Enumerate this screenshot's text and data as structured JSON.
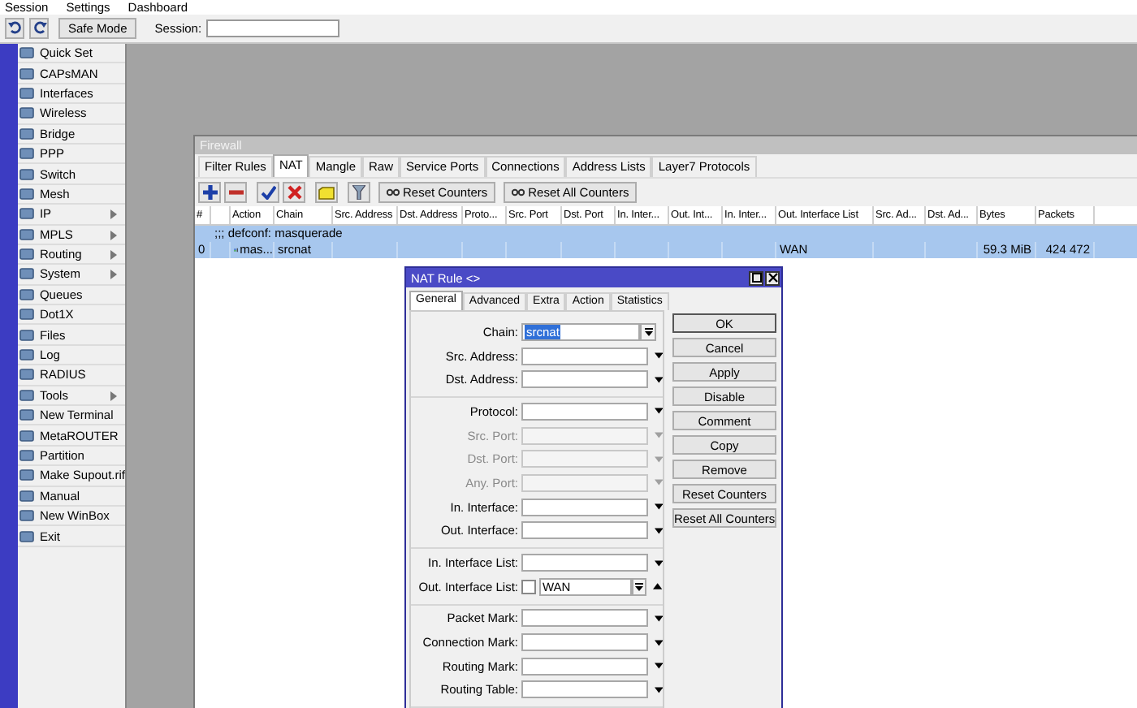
{
  "menu_bar": [
    "Session",
    "Settings",
    "Dashboard"
  ],
  "toolbar": {
    "safe_mode": "Safe Mode",
    "session_label": "Session:"
  },
  "sidebar": {
    "items": [
      {
        "label": "Quick Set",
        "submenu": false
      },
      {
        "label": "CAPsMAN",
        "submenu": false
      },
      {
        "label": "Interfaces",
        "submenu": false
      },
      {
        "label": "Wireless",
        "submenu": false
      },
      {
        "label": "Bridge",
        "submenu": false
      },
      {
        "label": "PPP",
        "submenu": false
      },
      {
        "label": "Switch",
        "submenu": false
      },
      {
        "label": "Mesh",
        "submenu": false
      },
      {
        "label": "IP",
        "submenu": true
      },
      {
        "label": "MPLS",
        "submenu": true
      },
      {
        "label": "Routing",
        "submenu": true
      },
      {
        "label": "System",
        "submenu": true
      },
      {
        "label": "Queues",
        "submenu": false
      },
      {
        "label": "Dot1X",
        "submenu": false
      },
      {
        "label": "Files",
        "submenu": false
      },
      {
        "label": "Log",
        "submenu": false
      },
      {
        "label": "RADIUS",
        "submenu": false
      },
      {
        "label": "Tools",
        "submenu": true
      },
      {
        "label": "New Terminal",
        "submenu": false
      },
      {
        "label": "MetaROUTER",
        "submenu": false
      },
      {
        "label": "Partition",
        "submenu": false
      },
      {
        "label": "Make Supout.rif",
        "submenu": false
      },
      {
        "label": "Manual",
        "submenu": false
      },
      {
        "label": "New WinBox",
        "submenu": false
      },
      {
        "label": "Exit",
        "submenu": false
      }
    ]
  },
  "firewall": {
    "title": "Firewall",
    "tabs": [
      {
        "label": "Filter Rules",
        "selected": false
      },
      {
        "label": "NAT",
        "selected": true
      },
      {
        "label": "Mangle",
        "selected": false
      },
      {
        "label": "Raw",
        "selected": false
      },
      {
        "label": "Service Ports",
        "selected": false
      },
      {
        "label": "Connections",
        "selected": false
      },
      {
        "label": "Address Lists",
        "selected": false
      },
      {
        "label": "Layer7 Protocols",
        "selected": false
      }
    ],
    "buttons": [
      "Reset Counters",
      "Reset All Counters"
    ],
    "table": {
      "columns": [
        "#",
        null,
        "Action",
        "Chain",
        "Src. Address",
        "Dst. Address",
        "Proto...",
        "Src. Port",
        "Dst. Port",
        "In. Inter...",
        "Out. Int...",
        "In. Inter...",
        "Out. Interface List",
        "Src. Ad...",
        "Dst. Ad...",
        "Bytes",
        "Packets"
      ],
      "rows": [
        {
          "kind": "comment",
          "text": ";;; defconf: masquerade",
          "selected": true
        },
        {
          "kind": "rule",
          "selected": true,
          "cells": [
            "0",
            null,
            "mas...",
            "srcnat",
            null,
            null,
            null,
            null,
            null,
            null,
            null,
            null,
            "WAN",
            null,
            null,
            "59.3 MiB",
            "424 472"
          ]
        }
      ]
    }
  },
  "dialog": {
    "title": "NAT Rule <>",
    "tabs": [
      {
        "label": "General",
        "selected": true
      },
      {
        "label": "Advanced",
        "selected": false
      },
      {
        "label": "Extra",
        "selected": false
      },
      {
        "label": "Action",
        "selected": false
      },
      {
        "label": "Statistics",
        "selected": false
      }
    ],
    "groups": [
      [
        {
          "kind": "combo",
          "label": "Chain:",
          "value": "srcnat",
          "text_selected": true,
          "disabled": false
        },
        {
          "kind": "dropdown",
          "label": "Src. Address:",
          "disabled": false
        },
        {
          "kind": "dropdown",
          "label": "Dst. Address:",
          "disabled": false
        }
      ],
      [
        {
          "kind": "dropdown",
          "label": "Protocol:",
          "disabled": false
        },
        {
          "kind": "dropdown",
          "label": "Src. Port:",
          "disabled": true
        },
        {
          "kind": "dropdown",
          "label": "Dst. Port:",
          "disabled": true
        },
        {
          "kind": "dropdown",
          "label": "Any. Port:",
          "disabled": true
        },
        {
          "kind": "dropdown",
          "label": "In. Interface:",
          "disabled": false
        },
        {
          "kind": "dropdown",
          "label": "Out. Interface:",
          "disabled": false
        }
      ],
      [
        {
          "kind": "dropdown",
          "label": "In. Interface List:",
          "disabled": false
        },
        {
          "kind": "list_check",
          "label": "Out. Interface List:",
          "value": "WAN",
          "checked": false,
          "disabled": false
        }
      ],
      [
        {
          "kind": "dropdown",
          "label": "Packet Mark:",
          "disabled": false
        },
        {
          "kind": "dropdown",
          "label": "Connection Mark:",
          "disabled": false
        },
        {
          "kind": "dropdown",
          "label": "Routing Mark:",
          "disabled": false
        },
        {
          "kind": "dropdown",
          "label": "Routing Table:",
          "disabled": false
        }
      ]
    ],
    "button_groups": [
      [
        "OK",
        "Cancel",
        "Apply"
      ],
      [
        "Disable",
        "Comment",
        "Copy",
        "Remove",
        "Reset Counters",
        "Reset All Counters"
      ]
    ]
  }
}
